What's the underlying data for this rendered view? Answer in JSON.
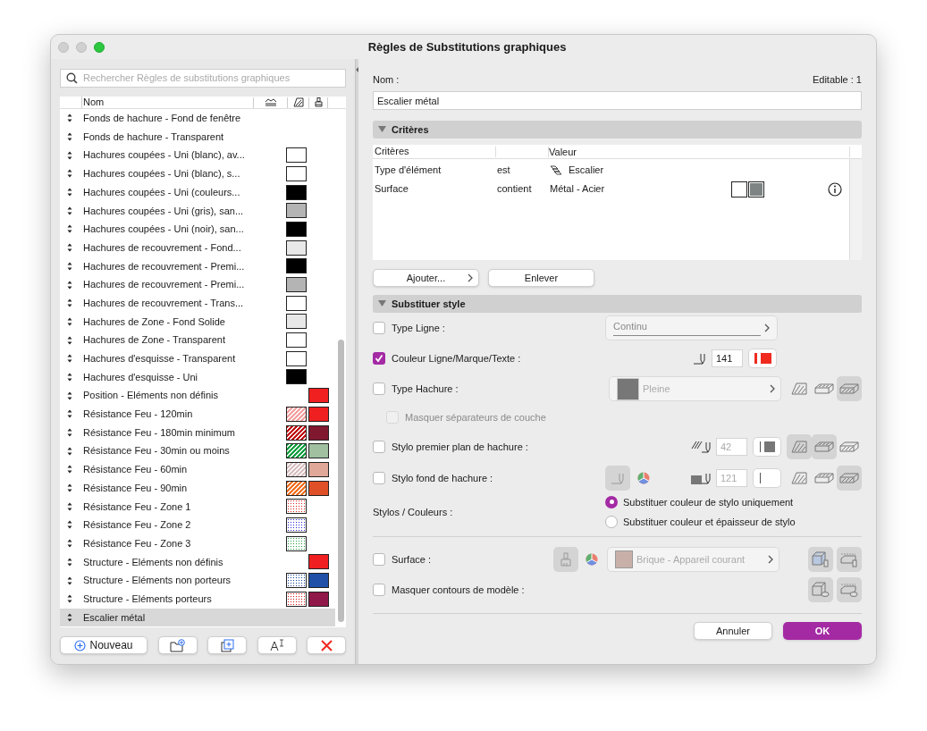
{
  "window": {
    "title": "Règles de Substitutions graphiques"
  },
  "sidebar": {
    "search": {
      "placeholder": "Rechercher Règles de substitutions graphiques"
    },
    "header": {
      "name": "Nom"
    },
    "rules": [
      {
        "name": "Fonds de hachure  - Fond de fenêtre",
        "selected": false
      },
      {
        "name": "Fonds de hachure  - Transparent",
        "selected": false
      },
      {
        "name": "Hachures coupées - Uni (blanc), av...",
        "selected": false,
        "fill": {
          "kind": "solid",
          "color": "#ffffff"
        }
      },
      {
        "name": "Hachures coupées - Uni (blanc), s...",
        "selected": false,
        "fill": {
          "kind": "solid",
          "color": "#ffffff"
        }
      },
      {
        "name": "Hachures coupées - Uni (couleurs...",
        "selected": false,
        "fill": {
          "kind": "solid",
          "color": "#000000"
        }
      },
      {
        "name": "Hachures coupées - Uni (gris), san...",
        "selected": false,
        "fill": {
          "kind": "solid",
          "color": "#b4b4b4"
        }
      },
      {
        "name": "Hachures coupées - Uni (noir), san...",
        "selected": false,
        "fill": {
          "kind": "solid",
          "color": "#000000"
        }
      },
      {
        "name": "Hachures de recouvrement - Fond...",
        "selected": false,
        "fill": {
          "kind": "solid",
          "color": "#e8e8e8"
        }
      },
      {
        "name": "Hachures de recouvrement - Premi...",
        "selected": false,
        "fill": {
          "kind": "solid",
          "color": "#000000"
        }
      },
      {
        "name": "Hachures de recouvrement - Premi...",
        "selected": false,
        "fill": {
          "kind": "solid",
          "color": "#b4b4b4"
        }
      },
      {
        "name": "Hachures de recouvrement - Trans...",
        "selected": false,
        "fill": {
          "kind": "solid",
          "color": "#ffffff"
        }
      },
      {
        "name": "Hachures de Zone - Fond Solide",
        "selected": false,
        "fill": {
          "kind": "solid",
          "color": "#e8e8e8"
        }
      },
      {
        "name": "Hachures de Zone - Transparent",
        "selected": false,
        "fill": {
          "kind": "solid",
          "color": "#ffffff"
        }
      },
      {
        "name": "Hachures d'esquisse - Transparent",
        "selected": false,
        "fill": {
          "kind": "solid",
          "color": "#ffffff"
        }
      },
      {
        "name": "Hachures d'esquisse - Uni",
        "selected": false,
        "fill": {
          "kind": "solid",
          "color": "#000000"
        }
      },
      {
        "name": "Position - Eléments non définis",
        "selected": false,
        "pen": {
          "color": "#f02020"
        }
      },
      {
        "name": "Résistance Feu - 120min",
        "selected": false,
        "fill": {
          "kind": "hatch",
          "color": "#f4a0a0"
        },
        "pen": {
          "color": "#f02020"
        }
      },
      {
        "name": "Résistance Feu - 180min minimum",
        "selected": false,
        "fill": {
          "kind": "hatch",
          "color": "#c01010"
        },
        "pen": {
          "color": "#801830"
        }
      },
      {
        "name": "Résistance Feu - 30min ou moins",
        "selected": false,
        "fill": {
          "kind": "hatch",
          "color": "#10a040"
        },
        "pen": {
          "color": "#a0c0a0"
        }
      },
      {
        "name": "Résistance Feu - 60min",
        "selected": false,
        "fill": {
          "kind": "hatch",
          "color": "#d8c0c0"
        },
        "pen": {
          "color": "#e0a898"
        }
      },
      {
        "name": "Résistance Feu - 90min",
        "selected": false,
        "fill": {
          "kind": "hatch",
          "color": "#f07020"
        },
        "pen": {
          "color": "#e05028"
        }
      },
      {
        "name": "Résistance Feu - Zone 1",
        "selected": false,
        "fill": {
          "kind": "dots",
          "color": "#e02020"
        }
      },
      {
        "name": "Résistance Feu - Zone 2",
        "selected": false,
        "fill": {
          "kind": "dots",
          "color": "#2020e0"
        }
      },
      {
        "name": "Résistance Feu - Zone 3",
        "selected": false,
        "fill": {
          "kind": "dots",
          "color": "#20a040"
        }
      },
      {
        "name": "Structure - Eléments non définis",
        "selected": false,
        "pen": {
          "color": "#f02020"
        }
      },
      {
        "name": "Structure - Eléments non porteurs",
        "selected": false,
        "fill": {
          "kind": "dots",
          "color": "#1040a0"
        },
        "pen": {
          "color": "#2050a8"
        }
      },
      {
        "name": "Structure - Eléments porteurs",
        "selected": false,
        "fill": {
          "kind": "dots",
          "color": "#e01010"
        },
        "pen": {
          "color": "#901848"
        }
      },
      {
        "name": "Escalier métal",
        "selected": true
      }
    ],
    "buttons": [
      {
        "kind": "new",
        "label": "Nouveau"
      },
      {
        "kind": "folder"
      },
      {
        "kind": "duplicate"
      },
      {
        "kind": "rename"
      },
      {
        "kind": "delete"
      }
    ]
  },
  "editor": {
    "name_label": "Nom :",
    "editable": "Editable : 1",
    "name_value": "Escalier métal",
    "criteria": {
      "title": "Critères",
      "expanded": true,
      "columns": [
        "Critères",
        "Valeur"
      ],
      "rows": [
        {
          "kind": "element",
          "criterion": "Type d'élément",
          "operator": "est",
          "value": "Escalier"
        },
        {
          "kind": "surface",
          "criterion": "Surface",
          "operator": "contient",
          "value": "Métal - Acier"
        }
      ]
    },
    "criteria_buttons": [
      {
        "kind": "menu",
        "label": "Ajouter..."
      },
      {
        "kind": "plain",
        "label": "Enlever"
      }
    ],
    "style": {
      "title": "Substituer style",
      "expanded": true,
      "options": [
        {
          "kind": "linetype",
          "label": "Type Ligne :",
          "checked": false,
          "value": "Continu"
        },
        {
          "kind": "pencolor",
          "label": "Couleur Ligne/Marque/Texte :",
          "checked": true,
          "pen": "141",
          "color": "#f02a1e"
        },
        {
          "kind": "hatch",
          "label": "Type Hachure :",
          "checked": false,
          "value": "Pleine"
        },
        {
          "kind": "sub",
          "label": "Masquer séparateurs de couche",
          "checked": false,
          "disabled": true
        },
        {
          "kind": "fgpen",
          "label": "Stylo premier plan de hachure :",
          "checked": false,
          "pen": "42"
        },
        {
          "kind": "bgpen",
          "label": "Stylo fond de hachure :",
          "checked": false,
          "pen": "121"
        }
      ],
      "pens_label": "Stylos / Couleurs :",
      "pen_modes": [
        {
          "label": "Substituer couleur de stylo uniquement",
          "selected": true
        },
        {
          "label": "Substituer couleur et épaisseur de stylo",
          "selected": false
        }
      ],
      "surface": {
        "label": "Surface :",
        "checked": false,
        "value": "Brique - Appareil courant"
      },
      "hide_contours": {
        "label": "Masquer contours de modèle :",
        "checked": false
      }
    }
  },
  "buttons": [
    {
      "kind": "cancel",
      "label": "Annuler"
    },
    {
      "kind": "default",
      "label": "OK"
    }
  ]
}
